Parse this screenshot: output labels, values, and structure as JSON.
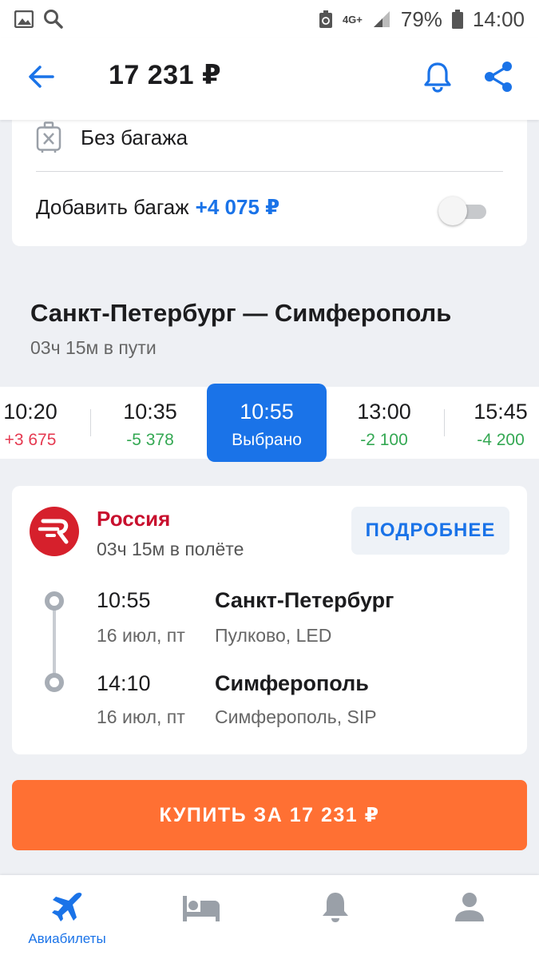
{
  "status_bar": {
    "network_top": "4G+",
    "battery_percent": "79%",
    "time": "14:00"
  },
  "header": {
    "price": "17 231 ₽"
  },
  "baggage": {
    "no_baggage_label": "Без багажа",
    "add_baggage_label": "Добавить багаж",
    "add_baggage_price": "+4 075 ₽",
    "add_baggage_enabled": false
  },
  "route": {
    "title": "Санкт-Петербург — Симферополь",
    "duration": "03ч 15м в пути"
  },
  "time_options": [
    {
      "time": "10:20",
      "delta": "+3 675",
      "selected": false
    },
    {
      "time": "10:35",
      "delta": "-5 378",
      "selected": false
    },
    {
      "time": "10:55",
      "delta": "Выбрано",
      "selected": true
    },
    {
      "time": "13:00",
      "delta": "-2 100",
      "selected": false
    },
    {
      "time": "15:45",
      "delta": "-4 200",
      "selected": false
    }
  ],
  "flight": {
    "airline": "Россия",
    "flight_duration": "03ч 15м в полёте",
    "details_label": "ПОДРОБНЕЕ",
    "departure": {
      "time": "10:55",
      "date": "16 июл, пт",
      "city": "Санкт-Петербург",
      "airport": "Пулково, LED"
    },
    "arrival": {
      "time": "14:10",
      "date": "16 июл, пт",
      "city": "Симферополь",
      "airport": "Симферополь, SIP"
    }
  },
  "buy_button": {
    "label": "КУПИТЬ ЗА 17 231 ₽"
  },
  "bottom_nav": {
    "items": [
      {
        "label": "Авиабилеты",
        "icon": "airplane-icon",
        "active": true
      },
      {
        "label": "",
        "icon": "bed-icon",
        "active": false
      },
      {
        "label": "",
        "icon": "bell-icon",
        "active": false
      },
      {
        "label": "",
        "icon": "profile-icon",
        "active": false
      }
    ]
  },
  "colors": {
    "accent": "#1a73e8",
    "buy": "#ff7033",
    "airline_red": "#c8102e",
    "discount_green": "#34a853",
    "surcharge_red": "#e53950"
  }
}
